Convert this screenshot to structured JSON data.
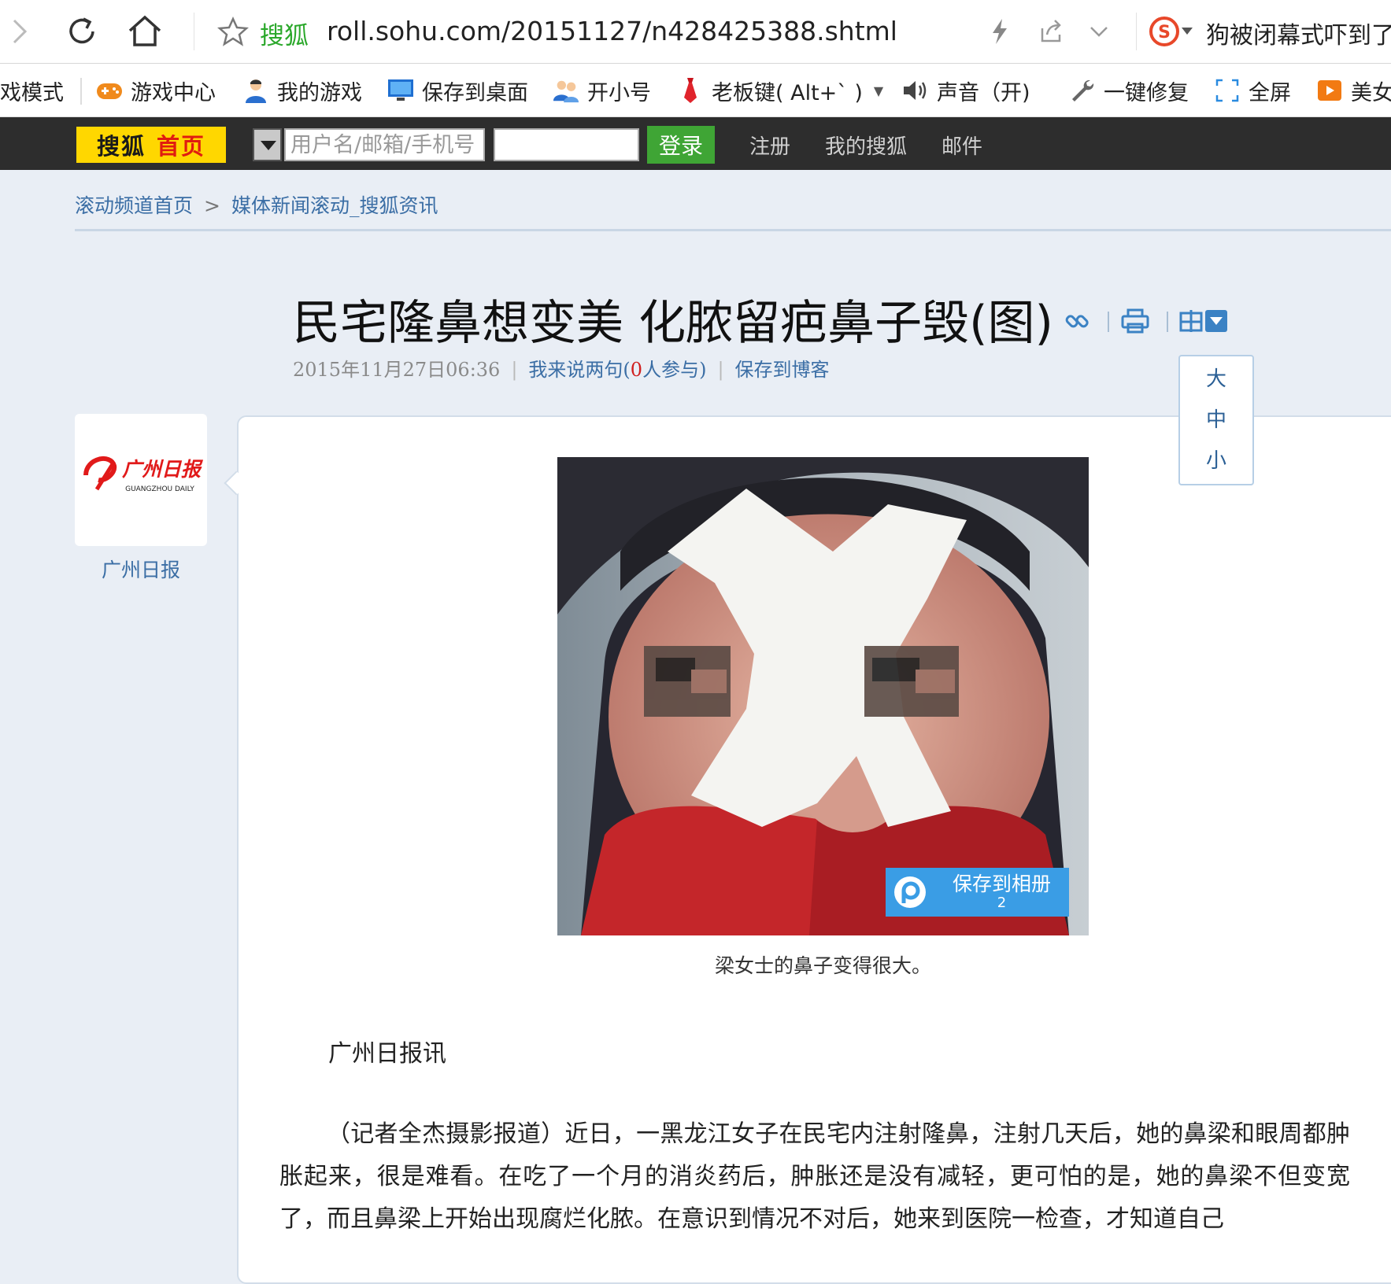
{
  "browser": {
    "search_brand": "搜狐",
    "url": "roll.sohu.com/20151127/n428425388.shtml",
    "news_ticker": "狗被闭幕式吓到了"
  },
  "bookmarks": [
    {
      "label": "戏模式",
      "icon": "none"
    },
    {
      "label": "游戏中心",
      "icon": "gamepad-icon"
    },
    {
      "label": "我的游戏",
      "icon": "user-icon"
    },
    {
      "label": "保存到桌面",
      "icon": "monitor-icon"
    },
    {
      "label": "开小号",
      "icon": "users-icon"
    },
    {
      "label": "老板键( Alt+` )",
      "icon": "necktie-icon"
    },
    {
      "label": "声音（开)",
      "icon": "speaker-icon"
    },
    {
      "label": "一键修复",
      "icon": "wrench-icon"
    },
    {
      "label": "全屏",
      "icon": "fullscreen-icon"
    },
    {
      "label": "美女",
      "icon": "video-icon"
    }
  ],
  "sohu_nav": {
    "logo_part1": "搜狐",
    "logo_part2": "首页",
    "username_placeholder": "用户名/邮箱/手机号",
    "login_label": "登录",
    "links": [
      "注册",
      "我的搜狐",
      "邮件"
    ]
  },
  "breadcrumb": {
    "items": [
      "滚动频道首页",
      "媒体新闻滚动_搜狐资讯"
    ],
    "separator": ">"
  },
  "article": {
    "title": "民宅隆鼻想变美 化脓留疤鼻子毁(图)",
    "date": "2015年11月27日06:36",
    "comment_prefix": "我来说两句(",
    "comment_count": "0",
    "comment_suffix": "人参与)",
    "save_blog": "保存到博客",
    "font_sizes": [
      "大",
      "中",
      "小"
    ],
    "source_name": "广州日报",
    "source_logo_cn": "广州日报",
    "source_logo_en": "GUANGZHOU DAILY",
    "save_album_label": "保存到相册",
    "save_album_count": "2",
    "caption": "梁女士的鼻子变得很大。",
    "lead": "广州日报讯",
    "paragraph": "（记者全杰摄影报道）近日，一黑龙江女子在民宅内注射隆鼻，注射几天后，她的鼻梁和眼周都肿胀起来，很是难看。在吃了一个月的消炎药后，肿胀还是没有减轻，更可怕的是，她的鼻梁不但变宽了，而且鼻梁上开始出现腐烂化脓。在意识到情况不对后，她来到医院一检查，才知道自己"
  },
  "colors": {
    "page_bg": "#e9eef5",
    "nav_bg": "#2d2d2d",
    "logo_yellow": "#ffd700",
    "login_green": "#3fa535",
    "link_blue": "#3b6ea5"
  }
}
